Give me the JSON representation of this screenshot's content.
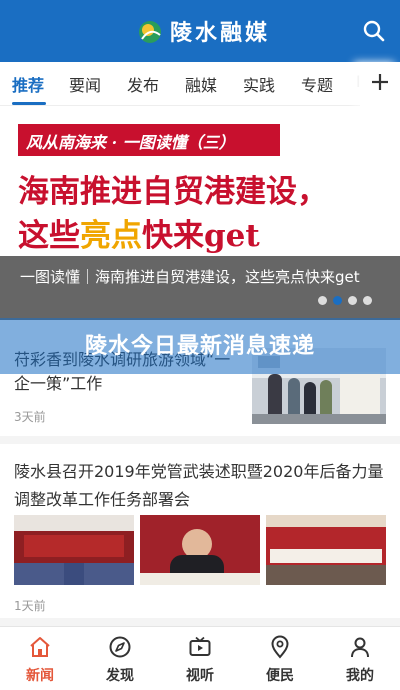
{
  "header": {
    "app_title": "陵水融媒",
    "brand_color": "#1a6ec2"
  },
  "tabs": [
    {
      "label": "推荐",
      "active": true
    },
    {
      "label": "要闻",
      "active": false
    },
    {
      "label": "发布",
      "active": false
    },
    {
      "label": "融媒",
      "active": false
    },
    {
      "label": "实践",
      "active": false
    },
    {
      "label": "专题",
      "active": false
    },
    {
      "label": "I",
      "active": false
    }
  ],
  "banner": {
    "tag": "风从南海来 · 一图读懂（三）",
    "headline_line1": "海南推进自贸港建设，",
    "headline_line2_a": "这些",
    "headline_line2_b": "亮点",
    "headline_line2_c": "快来get",
    "caption": "一图读懂｜海南推进自贸港建设，这些亮点快来get",
    "active_slide": 2,
    "slide_count": 4
  },
  "overlay": {
    "headline": "陵水今日最新消息速递"
  },
  "news": [
    {
      "title": "苻彩香到陵水调研旅游领域“一企一策”工作",
      "time": "3天前"
    },
    {
      "title": "陵水县召开2019年党管武装述职暨2020年后备力量调整改革工作任务部署会",
      "time": "1天前"
    }
  ],
  "bottom_nav": [
    {
      "label": "新闻",
      "icon": "home-icon",
      "active": true
    },
    {
      "label": "发现",
      "icon": "compass-icon",
      "active": false
    },
    {
      "label": "视听",
      "icon": "tv-icon",
      "active": false
    },
    {
      "label": "便民",
      "icon": "location-pin-icon",
      "active": false
    },
    {
      "label": "我的",
      "icon": "user-icon",
      "active": false
    }
  ],
  "colors": {
    "accent": "#1a6ec2",
    "active_nav": "#e4573a",
    "banner_red": "#c8102e"
  }
}
